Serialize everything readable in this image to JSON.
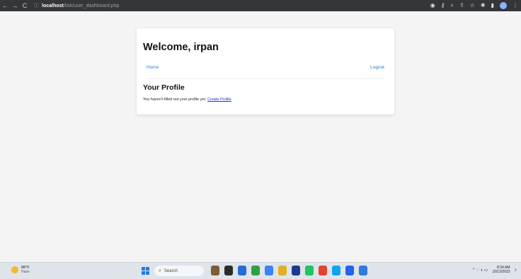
{
  "browser": {
    "back": "←",
    "forward": "→",
    "reload": "C",
    "url_host": "localhost",
    "url_path": "/tisk/user_dashboard.php"
  },
  "page": {
    "welcome": "Welcome, irpan",
    "nav": {
      "home": "Home",
      "logout": "Logout"
    },
    "profile_heading": "Your Profile",
    "profile_message": "You haven't filled out your profile yet.",
    "create_profile_link": "Create Profile"
  },
  "taskbar": {
    "weather_temp": "88°F",
    "weather_condition": "Haze",
    "search_label": "Search",
    "time": "8:34 AM",
    "date": "10/13/2023",
    "pinned_icons": [
      "files-icon",
      "explorer-icon",
      "chat-icon",
      "chrome-icon",
      "paint-icon",
      "folder-icon",
      "store-icon",
      "chrome-profile-icon",
      "chrome-icon-2",
      "edge-icon",
      "outlook-icon",
      "vscode-icon"
    ],
    "icon_colors": [
      "#7c5c3a",
      "#2b2b2b",
      "#1f6fd6",
      "#2f9e44",
      "#3b82f6",
      "#e0b020",
      "#1e3a8a",
      "#22c55e",
      "#e0442f",
      "#0ea5e9",
      "#2563eb",
      "#2f7bd9"
    ]
  }
}
